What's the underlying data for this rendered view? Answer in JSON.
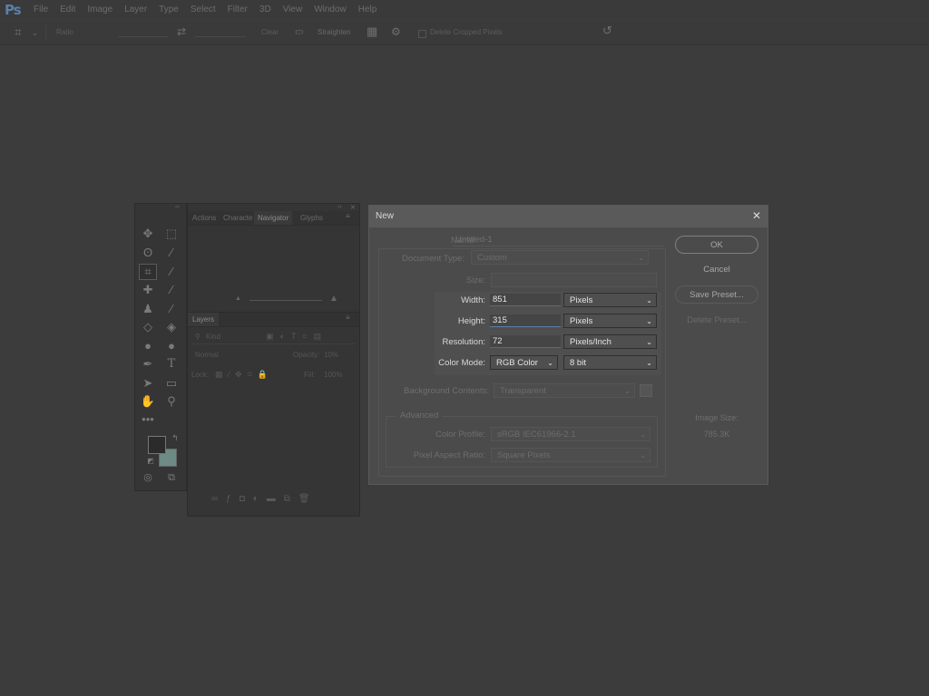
{
  "app": {
    "logo": "Ps"
  },
  "menu": [
    "File",
    "Edit",
    "Image",
    "Layer",
    "Type",
    "Select",
    "Filter",
    "3D",
    "View",
    "Window",
    "Help"
  ],
  "options_bar": {
    "ratio_label": "Ratio",
    "clear_label": "Clear",
    "straighten_label": "Straighten",
    "delete_cropped_label": "Delete Cropped Pixels"
  },
  "nav_panel": {
    "tabs": [
      "Actions",
      "Characte",
      "Navigator",
      "Glyphs"
    ]
  },
  "layers_panel": {
    "tab": "Layers",
    "kind_label": "Kind",
    "blend_mode": "Normal",
    "opacity_label": "Opacity:",
    "opacity_value": "10%",
    "lock_label": "Lock:",
    "fill_label": "Fill:",
    "fill_value": "100%"
  },
  "dialog": {
    "title": "New",
    "close": "✕",
    "name_label": "Name:",
    "name_value": "Untitled-1",
    "doctype_label": "Document Type:",
    "doctype_value": "Custom",
    "size_label": "Size:",
    "width_label": "Width:",
    "width_value": "851",
    "width_unit": "Pixels",
    "height_label": "Height:",
    "height_value": "315",
    "height_unit": "Pixels",
    "resolution_label": "Resolution:",
    "resolution_value": "72",
    "resolution_unit": "Pixels/Inch",
    "colormode_label": "Color Mode:",
    "colormode_value": "RGB Color",
    "bitdepth_value": "8 bit",
    "bg_label": "Background Contents:",
    "bg_value": "Transparent",
    "advanced_label": "Advanced",
    "profile_label": "Color Profile:",
    "profile_value": "sRGB IEC61966-2.1",
    "pixel_ratio_label": "Pixel Aspect Ratio:",
    "pixel_ratio_value": "Square Pixels",
    "ok": "OK",
    "cancel": "Cancel",
    "save_preset": "Save Preset...",
    "delete_preset": "Delete Preset...",
    "image_size_label": "Image Size:",
    "image_size_value": "785.3K"
  },
  "colors": {
    "foreground": "#2b2b2b",
    "background": "#6d8a85",
    "accent": "#5b7fa8"
  }
}
